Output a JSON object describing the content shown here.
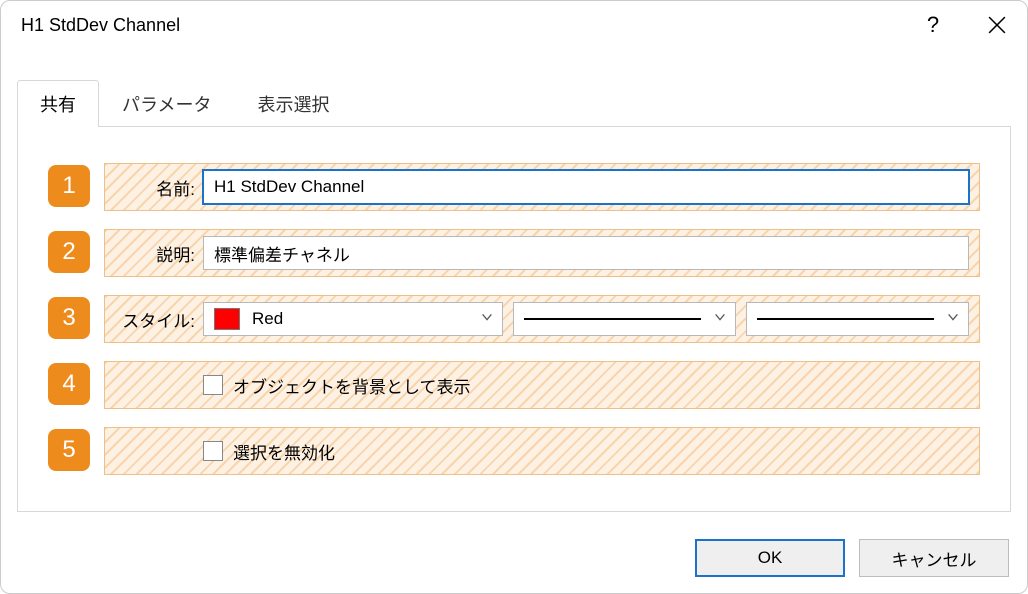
{
  "window": {
    "title": "H1 StdDev Channel"
  },
  "tabs": {
    "items": [
      {
        "label": "共有",
        "active": true
      },
      {
        "label": "パラメータ",
        "active": false
      },
      {
        "label": "表示選択",
        "active": false
      }
    ]
  },
  "rows": {
    "r1": {
      "num": "1",
      "label": "名前:",
      "value": "H1 StdDev Channel"
    },
    "r2": {
      "num": "2",
      "label": "説明:",
      "value": "標準偏差チャネル"
    },
    "r3": {
      "num": "3",
      "label": "スタイル:",
      "color_name": "Red",
      "color_hex": "#ff0000"
    },
    "r4": {
      "num": "4",
      "checkbox_label": "オブジェクトを背景として表示",
      "checked": false
    },
    "r5": {
      "num": "5",
      "checkbox_label": "選択を無効化",
      "checked": false
    }
  },
  "footer": {
    "ok": "OK",
    "cancel": "キャンセル"
  }
}
